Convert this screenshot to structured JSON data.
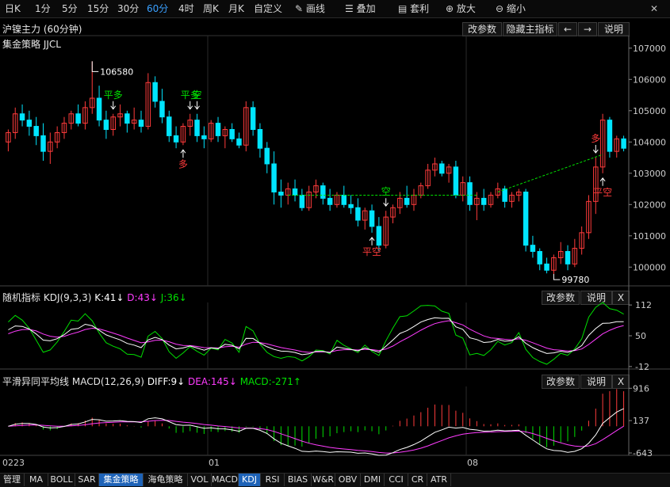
{
  "toolbar": {
    "periods": [
      "日K",
      "1分",
      "5分",
      "15分",
      "30分",
      "60分",
      "4时",
      "周K",
      "月K",
      "自定义"
    ],
    "active_period": "60分",
    "tools": [
      "画线",
      "叠加",
      "套利",
      "放大",
      "缩小"
    ]
  },
  "header": {
    "instrument": "沪镍主力 (60分钟)",
    "buttons": [
      "改参数",
      "隐藏主指标",
      "←",
      "→",
      "说明"
    ]
  },
  "main": {
    "strategy_label": "集金策略 JJCL"
  },
  "kdj": {
    "name": "随机指标",
    "params": "KDJ(9,3,3)",
    "k": "K:41↓",
    "d": "D:43↓",
    "j": "J:36↓",
    "buttons": [
      "改参数",
      "说明",
      "X"
    ]
  },
  "macd": {
    "name": "平滑异同平均线",
    "params": "MACD(12,26,9)",
    "diff": "DIFF:9↓",
    "dea": "DEA:145↓",
    "macd": "MACD:-271↑",
    "buttons": [
      "改参数",
      "说明",
      "X"
    ]
  },
  "dates": [
    "0223",
    "01",
    "08"
  ],
  "bottom_tabs": [
    "管理",
    "MA",
    "BOLL",
    "SAR",
    "集金策略",
    "海龟策略",
    "VOL",
    "MACD",
    "KDJ",
    "RSI",
    "BIAS",
    "W&R",
    "OBV",
    "DMI",
    "CCI",
    "CR",
    "ATR"
  ],
  "active_tabs": [
    "集金策略",
    "KDJ"
  ],
  "colors": {
    "up": "#ff3b3b",
    "down": "#00e5ff",
    "kdj_k": "#ffffff",
    "kdj_d": "#ff3cff",
    "kdj_j": "#00e000",
    "buy_signal": "#ff3b3b",
    "sell_signal": "#00e000",
    "trend": "#00e000",
    "active_tab": "#1e63b8"
  },
  "chart_data": {
    "type": "candlestick",
    "price_axis": {
      "ticks": [
        107000,
        106000,
        105000,
        104000,
        103000,
        102000,
        101000,
        100000
      ],
      "range": [
        99400,
        107400
      ]
    },
    "annotations": {
      "high": "106580",
      "low": "99780"
    },
    "signals": [
      "平多",
      "多",
      "平多",
      "空",
      "空",
      "平空",
      "多",
      "平空"
    ],
    "candles": [
      [
        104000,
        104400,
        103700,
        104300
      ],
      [
        104300,
        105100,
        104100,
        104900
      ],
      [
        104900,
        105200,
        104500,
        104700
      ],
      [
        104700,
        105000,
        104200,
        104500
      ],
      [
        104500,
        104800,
        103900,
        104200
      ],
      [
        104200,
        104600,
        103400,
        103700
      ],
      [
        103700,
        104300,
        103300,
        104000
      ],
      [
        104000,
        104500,
        103800,
        104300
      ],
      [
        104300,
        104800,
        104100,
        104600
      ],
      [
        104600,
        105000,
        104400,
        104900
      ],
      [
        104900,
        105200,
        104500,
        104600
      ],
      [
        104600,
        105300,
        104400,
        105100
      ],
      [
        105100,
        106580,
        104900,
        105400
      ],
      [
        105400,
        105800,
        104500,
        104700
      ],
      [
        104700,
        105000,
        104100,
        104400
      ],
      [
        104400,
        104900,
        104200,
        104800
      ],
      [
        104800,
        105200,
        104500,
        104900
      ],
      [
        104900,
        105000,
        104300,
        104600
      ],
      [
        104600,
        105100,
        104400,
        104700
      ],
      [
        104700,
        105000,
        104300,
        104500
      ],
      [
        104500,
        106200,
        104400,
        105900
      ],
      [
        105900,
        106100,
        105100,
        105300
      ],
      [
        105300,
        105700,
        104600,
        104800
      ],
      [
        104800,
        105000,
        104000,
        104200
      ],
      [
        104200,
        104500,
        103800,
        104000
      ],
      [
        104000,
        104600,
        103900,
        104500
      ],
      [
        104500,
        104900,
        104200,
        104700
      ],
      [
        104700,
        104900,
        104000,
        104200
      ],
      [
        104200,
        104500,
        103800,
        104100
      ],
      [
        104100,
        104700,
        104000,
        104600
      ],
      [
        104600,
        104800,
        104000,
        104200
      ],
      [
        104200,
        104500,
        103800,
        104400
      ],
      [
        104400,
        104600,
        104000,
        104100
      ],
      [
        104100,
        104300,
        103800,
        103900
      ],
      [
        103900,
        105300,
        103700,
        105100
      ],
      [
        105100,
        105300,
        104200,
        104400
      ],
      [
        104400,
        104600,
        103500,
        103800
      ],
      [
        103800,
        104000,
        103000,
        103300
      ],
      [
        103300,
        103700,
        102000,
        102400
      ],
      [
        102400,
        102800,
        101900,
        102300
      ],
      [
        102300,
        102700,
        102000,
        102500
      ],
      [
        102500,
        102800,
        102100,
        102300
      ],
      [
        102300,
        102500,
        101800,
        101900
      ],
      [
        101900,
        102600,
        101800,
        102400
      ],
      [
        102400,
        102800,
        102200,
        102600
      ],
      [
        102600,
        102700,
        102000,
        102200
      ],
      [
        102200,
        102500,
        101800,
        102000
      ],
      [
        102000,
        102400,
        101900,
        102300
      ],
      [
        102300,
        102600,
        101900,
        102000
      ],
      [
        102000,
        102300,
        101700,
        101900
      ],
      [
        101900,
        102200,
        101300,
        101500
      ],
      [
        101500,
        101900,
        101200,
        101800
      ],
      [
        101800,
        102000,
        101100,
        101300
      ],
      [
        101300,
        101600,
        100500,
        100700
      ],
      [
        100700,
        101800,
        100600,
        101600
      ],
      [
        101600,
        102000,
        101400,
        101900
      ],
      [
        101900,
        102400,
        101700,
        102200
      ],
      [
        102200,
        102600,
        101900,
        102000
      ],
      [
        102000,
        102500,
        101800,
        102300
      ],
      [
        102300,
        102700,
        102200,
        102600
      ],
      [
        102600,
        103300,
        102500,
        103100
      ],
      [
        103100,
        103500,
        102900,
        103300
      ],
      [
        103300,
        103400,
        102900,
        103000
      ],
      [
        103000,
        103300,
        102700,
        103200
      ],
      [
        103200,
        103400,
        102200,
        102300
      ],
      [
        102300,
        102900,
        102100,
        102700
      ],
      [
        102700,
        102900,
        101800,
        102000
      ],
      [
        102000,
        102400,
        101500,
        102200
      ],
      [
        102200,
        102500,
        101800,
        102000
      ],
      [
        102000,
        102400,
        101900,
        102300
      ],
      [
        102300,
        102700,
        102200,
        102500
      ],
      [
        102500,
        102600,
        101900,
        102100
      ],
      [
        102100,
        102400,
        101900,
        102300
      ],
      [
        102300,
        102500,
        102100,
        102400
      ],
      [
        102400,
        102500,
        100500,
        100700
      ],
      [
        100700,
        101000,
        100300,
        100500
      ],
      [
        100500,
        100600,
        99900,
        100100
      ],
      [
        100100,
        100300,
        99800,
        99900
      ],
      [
        99900,
        100400,
        99780,
        100300
      ],
      [
        100300,
        100800,
        100100,
        100500
      ],
      [
        100500,
        100700,
        99900,
        100100
      ],
      [
        100100,
        100900,
        100000,
        100600
      ],
      [
        100600,
        101300,
        100400,
        101100
      ],
      [
        101100,
        102300,
        100900,
        102100
      ],
      [
        102100,
        103500,
        101700,
        103200
      ],
      [
        103200,
        104900,
        103000,
        104700
      ],
      [
        104700,
        104800,
        103500,
        103700
      ],
      [
        103700,
        104200,
        103500,
        104100
      ],
      [
        104100,
        104200,
        103700,
        103800
      ]
    ],
    "kdj": {
      "axis_ticks": [
        "112",
        "50",
        "-12"
      ],
      "range": [
        -17,
        117
      ]
    },
    "macd": {
      "axis_ticks": [
        "916",
        "137",
        "-643"
      ],
      "range": [
        -700,
        960
      ]
    }
  }
}
